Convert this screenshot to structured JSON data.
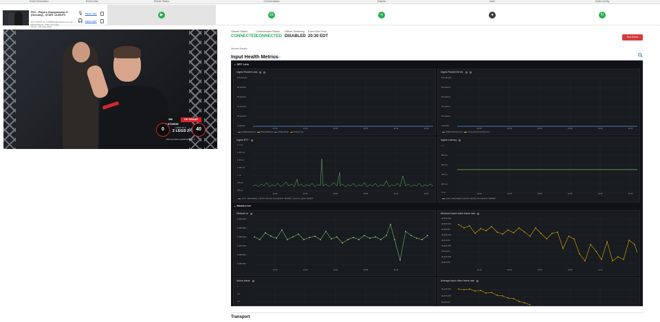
{
  "header": {
    "columns": [
      "Event Information",
      "Event Links",
      "Stream Status",
      "Commentators",
      "Outputs",
      "mme",
      "Audio Config"
    ]
  },
  "event": {
    "title": "PDC - Players Championship 17 (Germany) - START 13:00UTC",
    "sub_lines": [
      "#4 1778 PM TS_CAMERA@example.ceu.cam",
      "@2camcleow - PDC Coverage",
      "19:30 - 19th May 2023"
    ],
    "links": [
      {
        "icon": "microphone-icon",
        "label": "#4pcm topic"
      },
      {
        "icon": "headphones-icon",
        "label": "#4pcm topic"
      }
    ]
  },
  "status_buttons": [
    {
      "column": "Stream Status",
      "icon": "play-icon",
      "color": "#27ae4f"
    },
    {
      "column": "Commentators",
      "icon": "headset-icon",
      "color": "#27ae4f"
    },
    {
      "column": "Outputs",
      "icon": "share-icon",
      "color": "#27ae4f"
    },
    {
      "column": "mme",
      "icon": "user-icon",
      "color": "#3b3b3b"
    },
    {
      "column": "Audio Config",
      "icon": "refresh-icon",
      "color": "#27ae4f"
    }
  ],
  "video": {
    "scoreboard": {
      "left_name": "SM DELSTORGE",
      "right_name": "DE GRAAF",
      "left_score": "0",
      "right_score": "40",
      "middle": "2  LEGS  2",
      "middle_small": "FIRST TO 6",
      "footer": "2023 PLAYERS CHAMPIONSHIP 17"
    }
  },
  "status": {
    "items": [
      {
        "label": "Stream Status",
        "value": "CONNECTED",
        "color": "#27ae60"
      },
      {
        "label": "Commentator Status",
        "value": "CONNECTED",
        "color": "#27ae60"
      },
      {
        "label": "Hitless Switching",
        "value": "DISABLED",
        "color": "#111111"
      },
      {
        "label": "Event End Time",
        "value": "20:30 EDT",
        "color": "#111111"
      }
    ],
    "end_button": "End Event",
    "details_label": "Stream Details"
  },
  "health": {
    "title": "Input Health Metrics",
    "tag": "collapse",
    "srt_section": "SRT Link",
    "media_section": "Media Live",
    "panels": {
      "packet_loss": {
        "title": "Ingest Packet Loss",
        "y_ticks": [
          "100 packets",
          "80 packets",
          "60 packets",
          "40 packets",
          "20 packets",
          "0 packets"
        ],
        "x_ticks": [
          "10:40",
          "10:45",
          "10:50",
          "10:55",
          "11:00",
          "11:05"
        ],
        "legend": [
          "TotalPacketsDrop",
          "PktSentBeforeA",
          "PktRecvDrop",
          "Packet Loss"
        ]
      },
      "packet_errors": {
        "title": "Ingest Packet Errors",
        "y_ticks": [
          "100 packets",
          "80 packets",
          "60 packets",
          "40 packets",
          "20 packets",
          "0 packets"
        ],
        "x_ticks": [
          "10:40",
          "10:45",
          "10:50",
          "10:55",
          "11:00",
          "11:05"
        ],
        "legend": [
          "NotRecvPacketCount",
          "ContinuityCounterErrCount"
        ]
      },
      "rtt": {
        "title": "Ingest RTT",
        "y_ticks": [
          "1.1 ms",
          "1.075 ms",
          "1.05 ms",
          "1.025 ms",
          "1 ms",
          "975 µs",
          "950 µs"
        ],
        "x_ticks": [
          "10:40",
          "10:45",
          "10:50",
          "10:55",
          "11:00",
          "11:05"
        ],
        "legend": "metric, Metricslabel / {4d.227.244.3}C, RemoteFortr \"403493\", resource_name=\"MJSFT\""
      },
      "latency": {
        "title": "Ingest Latency",
        "y_ticks": [
          "1 s",
          "800 ms",
          "600 ms",
          "400 ms",
          "200 ms",
          "0 ms"
        ],
        "x_ticks": [
          "10:40",
          "10:45",
          "10:50",
          "10:55",
          "11:00",
          "11:05"
        ],
        "legend": "metric, Metricslabel / {4d.227.244.3}C, RemoteFortr \"403493\""
      },
      "network_in": {
        "title": "Network In",
        "y_ticks": [
          "8.387 Mb/s",
          "8.386 Mb/s",
          "8.385 Mb/s",
          "8.384 Mb/s",
          "8.383 Mb/s",
          "8.382 Mb/s"
        ],
        "x_ticks": [
          "10:40",
          "10:45",
          "10:50",
          "10:55",
          "11:00"
        ]
      },
      "min_frame_rate": {
        "title": "Minimum input video frame rate",
        "y_ticks": [
          "49.659 FPS",
          "49.655 FPS",
          "49.65 FPS",
          "49.645 FPS",
          "49.64 FPS",
          "49.635 FPS",
          "49.63 FPS",
          "49.625 FPS",
          "49.62 FPS"
        ],
        "x_ticks": [
          "10:40",
          "10:45",
          "10:50",
          "10:55",
          "11:00"
        ]
      },
      "active_alerts": {
        "title": "Active alerts",
        "y_ticks": [
          "1",
          "0.8",
          "0.6"
        ]
      },
      "avg_frame_rate": {
        "title": "Average input video frame rate",
        "y_ticks": [
          "50.125 FPS",
          "50.075 FPS",
          "50.05 FPS"
        ]
      }
    }
  },
  "transport": {
    "title": "Transport"
  }
}
